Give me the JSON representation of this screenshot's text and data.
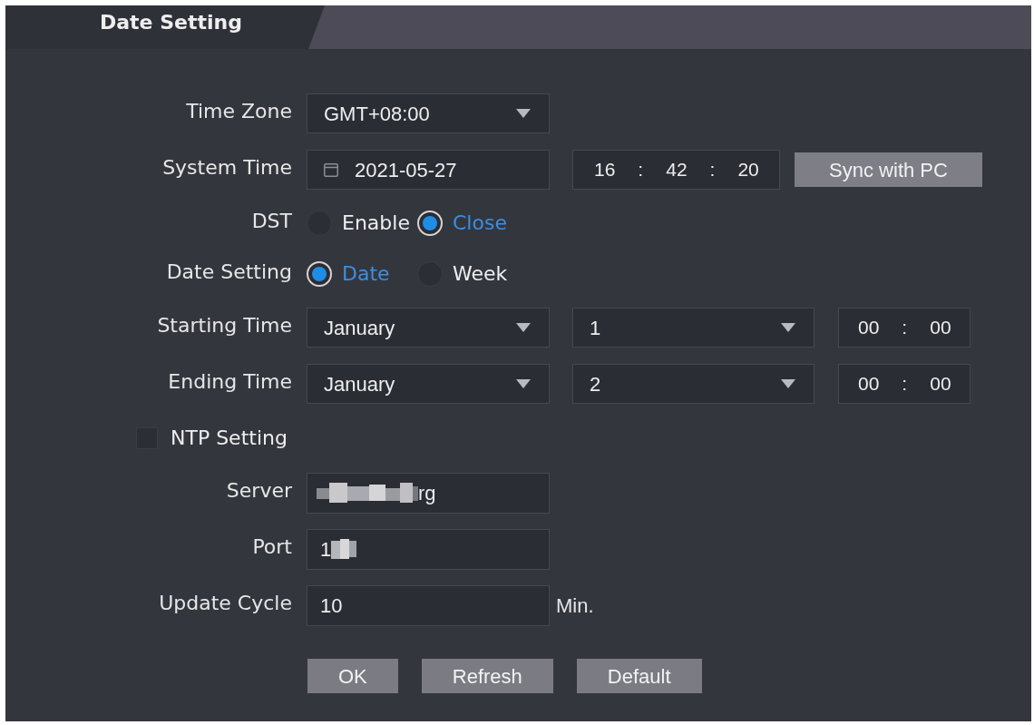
{
  "tab": {
    "title": "Date Setting"
  },
  "rows": [
    {
      "kind": "select",
      "label": "Time Zone",
      "value": "GMT+08:00"
    },
    {
      "kind": "datetime",
      "label": "System Time",
      "date": "2021-05-27",
      "time": [
        "16",
        ":",
        "42",
        ":",
        "20"
      ],
      "button": "Sync with PC"
    },
    {
      "kind": "radio",
      "label": "DST",
      "options": [
        {
          "label": "Enable",
          "selected": false
        },
        {
          "label": "Close",
          "selected": true
        }
      ]
    },
    {
      "kind": "radio",
      "label": "Date Setting",
      "options": [
        {
          "label": "Date",
          "selected": true
        },
        {
          "label": "Week",
          "selected": false
        }
      ]
    },
    {
      "kind": "period",
      "label": "Starting Time",
      "month": "January",
      "day": "1",
      "time": [
        "00",
        ":",
        "00"
      ]
    },
    {
      "kind": "period",
      "label": "Ending Time",
      "month": "January",
      "day": "2",
      "time": [
        "00",
        ":",
        "00"
      ]
    },
    {
      "kind": "checkbox",
      "label": "NTP Setting",
      "checked": false
    },
    {
      "kind": "text",
      "label": "Server",
      "value": "rg",
      "mask_before": true,
      "mask_after": false
    },
    {
      "kind": "text",
      "label": "Port",
      "value": "1",
      "mask_before": false,
      "mask_after": true
    },
    {
      "kind": "text",
      "label": "Update Cycle",
      "value": "10",
      "unit": "Min."
    }
  ],
  "buttons": [
    "OK",
    "Refresh",
    "Default"
  ]
}
